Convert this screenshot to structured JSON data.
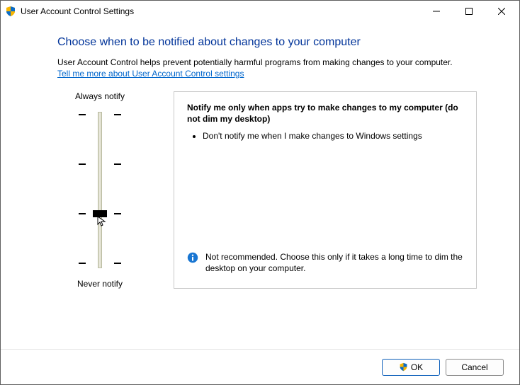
{
  "window": {
    "title": "User Account Control Settings"
  },
  "page": {
    "heading": "Choose when to be notified about changes to your computer",
    "description": "User Account Control helps prevent potentially harmful programs from making changes to your computer.",
    "link_text": "Tell me more about User Account Control settings"
  },
  "slider": {
    "top_label": "Always notify",
    "bottom_label": "Never notify",
    "level": 1
  },
  "info": {
    "title": "Notify me only when apps try to make changes to my computer (do not dim my desktop)",
    "bullet1": "Don't notify me when I make changes to Windows settings",
    "warning": "Not recommended. Choose this only if it takes a long time to dim the desktop on your computer."
  },
  "buttons": {
    "ok": "OK",
    "cancel": "Cancel"
  }
}
